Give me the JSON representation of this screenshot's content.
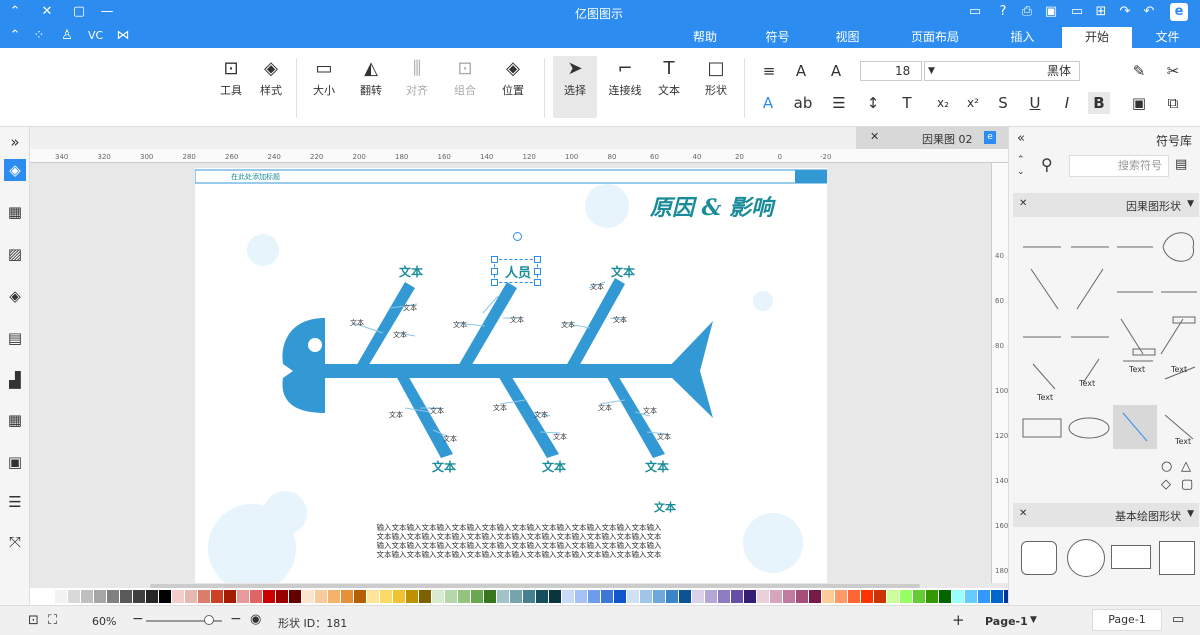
{
  "app": {
    "title": "亿图图示"
  },
  "menus": {
    "file": "文件",
    "start": "开始",
    "insert": "插入",
    "layout": "页面布局",
    "view": "视图",
    "symbol": "符号",
    "help": "帮助"
  },
  "topleft": {
    "vc": "VC"
  },
  "ribbon": {
    "cut": "剪切",
    "paste": "粘贴",
    "font_name": "黑体",
    "font_size": "18",
    "text_label": "文本",
    "shape_label": "形状",
    "connector_label": "连接线",
    "select_label": "选择",
    "position_label": "位置",
    "group_label": "组合",
    "align_label": "对齐",
    "flip_label": "翻转",
    "size_label": "大小",
    "style_label": "样式",
    "tools_label": "工具"
  },
  "doctab": {
    "name": "因果图 02"
  },
  "ruler": {
    "h": [
      "-20",
      "0",
      "20",
      "40",
      "60",
      "80",
      "100",
      "120",
      "140",
      "160",
      "180",
      "200",
      "220",
      "240",
      "260",
      "280",
      "300",
      "320",
      "340",
      "360"
    ],
    "v": [
      "40",
      "60",
      "80",
      "100",
      "120",
      "140",
      "160",
      "180"
    ]
  },
  "diagram": {
    "title": "原因 & 影响",
    "header_text": "在此处添加标题",
    "selected_label": "人员",
    "big_labels": [
      "文本",
      "文本",
      "文本",
      "文本",
      "文本"
    ],
    "small_label": "文本",
    "bottom_label": "文本",
    "body_text": [
      "输入文本输入文本输入文本输入文本输入文本输入文本输入文本输入文本输入文本输入",
      "文本输入文本输入文本输入文本输入文本输入文本输入文本输入文本输入文本输入文本",
      "输入文本输入文本输入文本输入文本输入文本输入文本输入文本输入文本输入文本输入",
      "文本输入文本输入文本输入文本输入文本输入文本输入文本输入文本输入文本输入文本"
    ]
  },
  "rightpanel": {
    "title": "符号库",
    "search_placeholder": "搜索符号",
    "section1": "因果图形状",
    "section2": "基本绘图形状",
    "text_items": [
      "Text",
      "Text",
      "Text",
      "Text",
      "Text"
    ]
  },
  "status": {
    "page_nav": "Page-1",
    "page_tab": "Page-1",
    "shape_id": "形状 ID：181",
    "zoom": "60%",
    "add": "+"
  },
  "colors": {
    "accent": "#2d8cf0",
    "fish": "#3399d4",
    "teal": "#1a8c99"
  },
  "palette": [
    "#ffffff",
    "#f2f2f2",
    "#d9d9d9",
    "#bfbfbf",
    "#a6a6a6",
    "#808080",
    "#595959",
    "#404040",
    "#262626",
    "#000000",
    "#f4cccc",
    "#e6b8af",
    "#dd7e6b",
    "#cc4125",
    "#a61c00",
    "#ea9999",
    "#e06666",
    "#cc0000",
    "#990000",
    "#660000",
    "#fce5cd",
    "#f9cb9c",
    "#f6b26b",
    "#e69138",
    "#b45f06",
    "#ffe599",
    "#ffd966",
    "#f1c232",
    "#bf9000",
    "#7f6000",
    "#d9ead3",
    "#b6d7a8",
    "#93c47d",
    "#6aa84f",
    "#38761d",
    "#a2c4c9",
    "#76a5af",
    "#45818e",
    "#134f5c",
    "#0c343d",
    "#c9daf8",
    "#a4c2f4",
    "#6d9eeb",
    "#3c78d8",
    "#1155cc",
    "#cfe2f3",
    "#9fc5e8",
    "#6fa8dc",
    "#3d85c6",
    "#0b5394",
    "#d9d2e9",
    "#b4a7d6",
    "#8e7cc3",
    "#674ea7",
    "#351c75",
    "#ead1dc",
    "#d5a6bd",
    "#c27ba0",
    "#a64d79",
    "#741b47",
    "#ffcc99",
    "#ff9966",
    "#ff6633",
    "#ff3300",
    "#cc3300",
    "#ccff99",
    "#99ff66",
    "#66cc33",
    "#339900",
    "#006600",
    "#99ffff",
    "#66ccff",
    "#3399ff",
    "#0066cc",
    "#003399",
    "#ff99cc",
    "#ff6699",
    "#ff3366",
    "#cc0033",
    "#990033"
  ]
}
